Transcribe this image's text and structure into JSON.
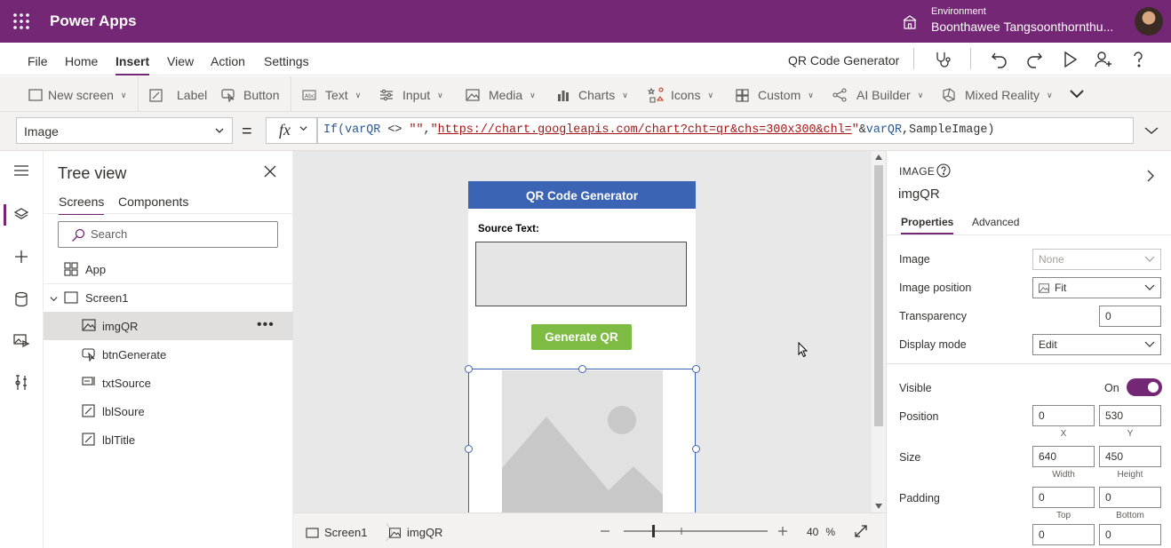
{
  "header": {
    "app_name": "Power Apps",
    "env_label": "Environment",
    "env_name": "Boonthawee Tangsoonthornthu..."
  },
  "menu": {
    "items": [
      "File",
      "Home",
      "Insert",
      "View",
      "Action",
      "Settings"
    ],
    "active": "Insert",
    "app_title": "QR Code Generator"
  },
  "ribbon": {
    "items": [
      "New screen",
      "Label",
      "Button",
      "Text",
      "Input",
      "Media",
      "Charts",
      "Icons",
      "Custom",
      "AI Builder",
      "Mixed Reality"
    ]
  },
  "formula_bar": {
    "property": "Image",
    "equals": "=",
    "fx": "fx",
    "formula_parts": {
      "p1": "If(",
      "p2": "varQR",
      "p3": " <> ",
      "p4": "\"\"",
      "p5": ",",
      "p6": "\"",
      "p7": "https://chart.googleapis.com/chart?cht=qr&chs=300x300&chl=",
      "p8": "\"",
      "p9": "&",
      "p10": "varQR",
      "p11": ",SampleImage)"
    }
  },
  "tree": {
    "title": "Tree view",
    "tabs": [
      "Screens",
      "Components"
    ],
    "search_placeholder": "Search",
    "items": {
      "app": "App",
      "screen1": "Screen1",
      "imgQR": "imgQR",
      "btnGenerate": "btnGenerate",
      "txtSource": "txtSource",
      "lblSoure": "lblSoure",
      "lblTitle": "lblTitle"
    }
  },
  "canvas": {
    "header_title": "QR Code Generator",
    "source_label": "Source Text:",
    "generate_button": "Generate QR"
  },
  "statusbar": {
    "screen": "Screen1",
    "control": "imgQR",
    "zoom": "40",
    "zoom_unit": "%",
    "zoom_fraction": 0.2
  },
  "properties": {
    "kind": "IMAGE",
    "control_name": "imgQR",
    "tabs": [
      "Properties",
      "Advanced"
    ],
    "image_label": "Image",
    "image_value": "None",
    "image_position_label": "Image position",
    "image_position_value": "Fit",
    "transparency_label": "Transparency",
    "transparency_value": "0",
    "display_mode_label": "Display mode",
    "display_mode_value": "Edit",
    "visible_label": "Visible",
    "visible_value": "On",
    "position_label": "Position",
    "position_x": "0",
    "position_y": "530",
    "x_label": "X",
    "y_label": "Y",
    "size_label": "Size",
    "width": "640",
    "height": "450",
    "width_label": "Width",
    "height_label": "Height",
    "padding_label": "Padding",
    "padding_top": "0",
    "padding_bottom": "0",
    "top_label": "Top",
    "bottom_label": "Bottom",
    "padding_left": "0",
    "padding_right": "0"
  },
  "colors": {
    "brand": "#742774",
    "canvas_header": "#3c64b4",
    "generate_button": "#7dbb42"
  }
}
